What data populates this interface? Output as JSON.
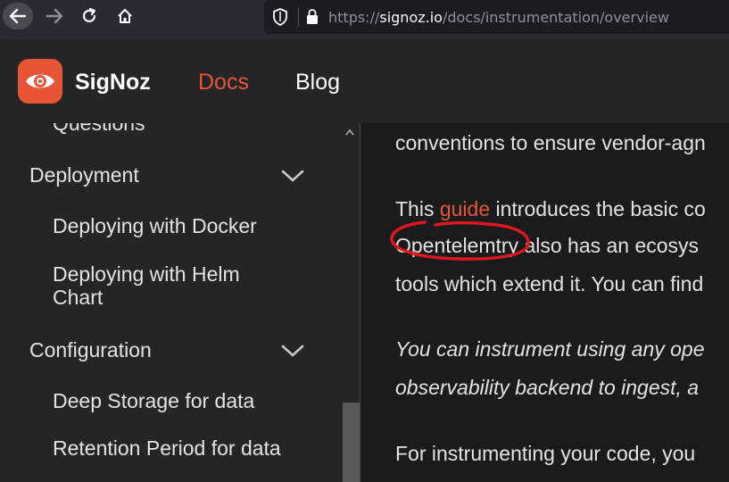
{
  "browser": {
    "url_prefix": "https://",
    "url_domain": "signoz.io",
    "url_path": "/docs/instrumentation/overview"
  },
  "header": {
    "brand": "SigNoz",
    "nav_docs": "Docs",
    "nav_blog": "Blog"
  },
  "sidebar": {
    "items": [
      {
        "label": "Questions"
      },
      {
        "label": "Deployment"
      },
      {
        "label": "Deploying with Docker"
      },
      {
        "label": "Deploying with Helm"
      },
      {
        "label": "Chart"
      },
      {
        "label": "Configuration"
      },
      {
        "label": "Deep Storage for data"
      },
      {
        "label": "Retention Period for data"
      }
    ]
  },
  "content": {
    "line1": "conventions to ensure vendor-agn",
    "line2_pre": "This ",
    "line2_link": "guide",
    "line2_post": " introduces the basic co",
    "line3": "Opentelemtry also has an ecosys",
    "line4": "tools which extend it. You can find",
    "line5": "You can instrument using any ope",
    "line6": "observability backend to ingest, a",
    "line7": "For instrumenting your code, you"
  },
  "colors": {
    "accent": "#e75536",
    "annotation": "#e0181e"
  }
}
